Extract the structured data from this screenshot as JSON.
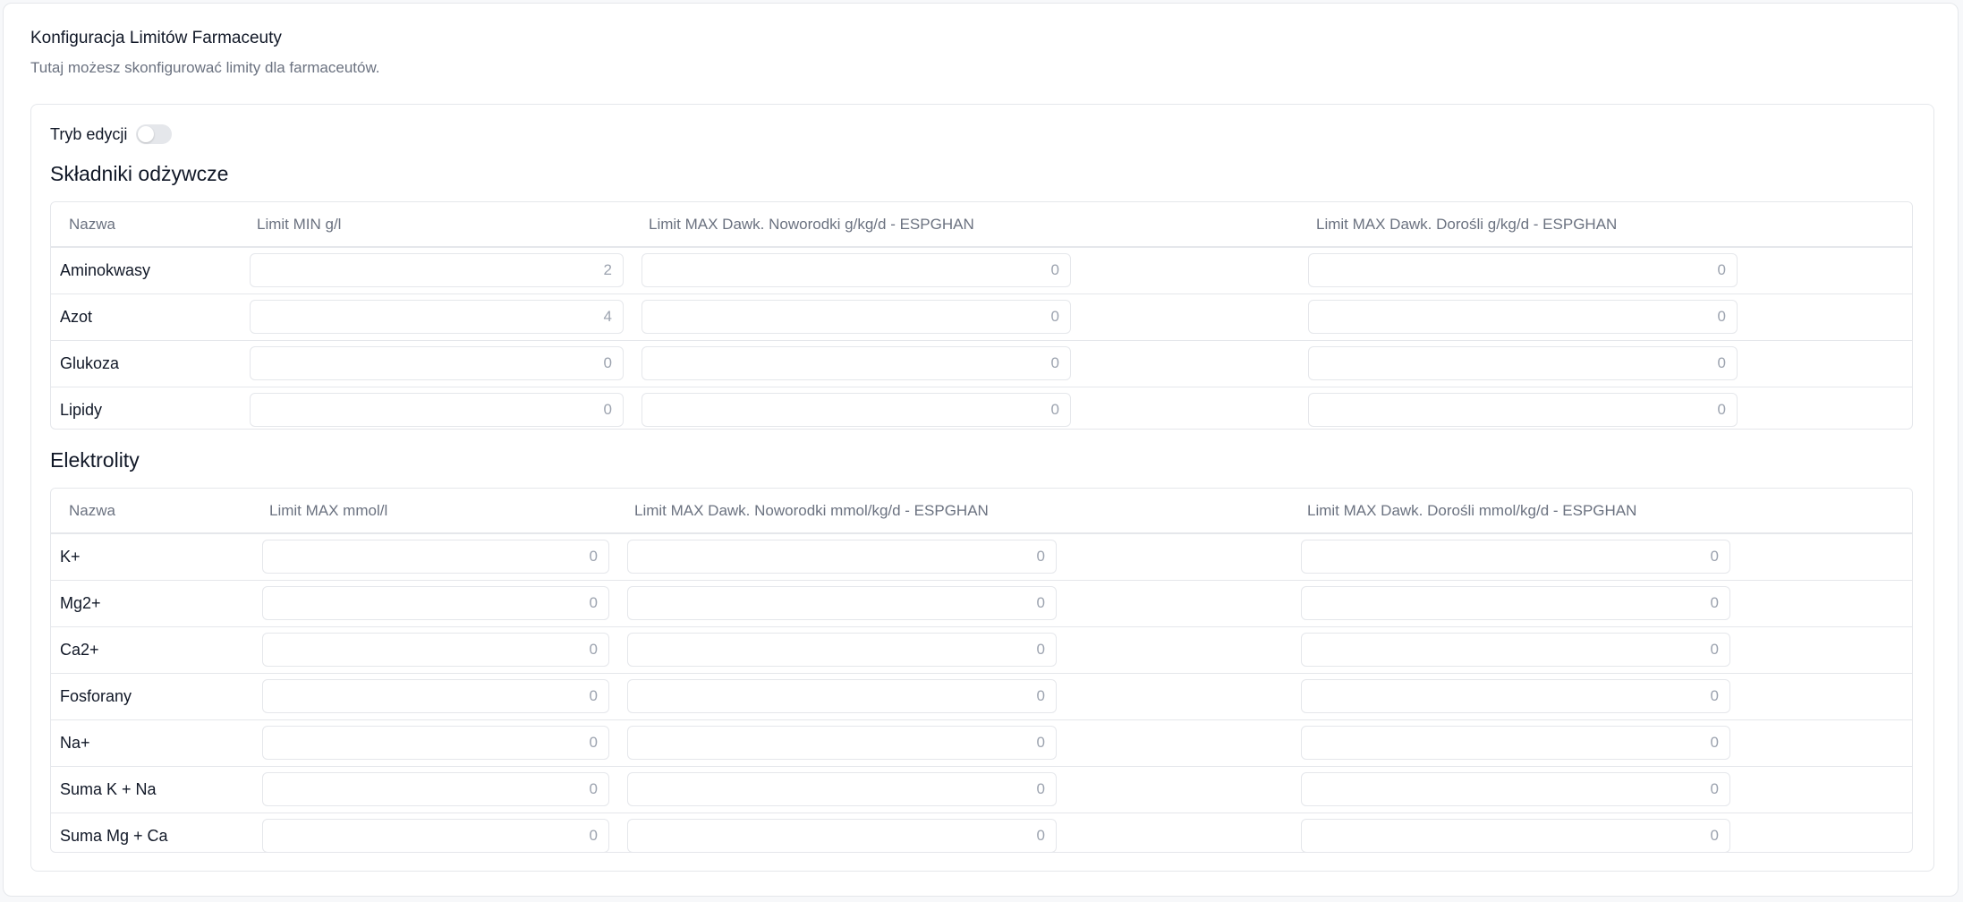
{
  "header": {
    "title": "Konfiguracja Limitów Farmaceuty",
    "subtitle": "Tutaj możesz skonfigurować limity dla farmaceutów."
  },
  "edit_mode": {
    "label": "Tryb edycji",
    "enabled": false
  },
  "nutrients": {
    "title": "Składniki odżywcze",
    "columns": [
      "Nazwa",
      "Limit MIN g/l",
      "Limit MAX Dawk. Noworodki g/kg/d - ESPGHAN",
      "Limit MAX Dawk. Dorośli g/kg/d - ESPGHAN"
    ],
    "rows": [
      {
        "name": "Aminokwasy",
        "values": [
          "2",
          "0",
          "0"
        ]
      },
      {
        "name": "Azot",
        "values": [
          "4",
          "0",
          "0"
        ]
      },
      {
        "name": "Glukoza",
        "values": [
          "0",
          "0",
          "0"
        ]
      },
      {
        "name": "Lipidy",
        "values": [
          "0",
          "0",
          "0"
        ]
      }
    ]
  },
  "electrolytes": {
    "title": "Elektrolity",
    "columns": [
      "Nazwa",
      "Limit MAX mmol/l",
      "Limit MAX Dawk. Noworodki mmol/kg/d - ESPGHAN",
      "Limit MAX Dawk. Dorośli mmol/kg/d - ESPGHAN"
    ],
    "rows": [
      {
        "name": "K+",
        "values": [
          "0",
          "0",
          "0"
        ]
      },
      {
        "name": "Mg2+",
        "values": [
          "0",
          "0",
          "0"
        ]
      },
      {
        "name": "Ca2+",
        "values": [
          "0",
          "0",
          "0"
        ]
      },
      {
        "name": "Fosforany",
        "values": [
          "0",
          "0",
          "0"
        ]
      },
      {
        "name": "Na+",
        "values": [
          "0",
          "0",
          "0"
        ]
      },
      {
        "name": "Suma K + Na",
        "values": [
          "0",
          "0",
          "0"
        ]
      },
      {
        "name": "Suma Mg + Ca",
        "values": [
          "0",
          "0",
          "0"
        ]
      }
    ]
  }
}
